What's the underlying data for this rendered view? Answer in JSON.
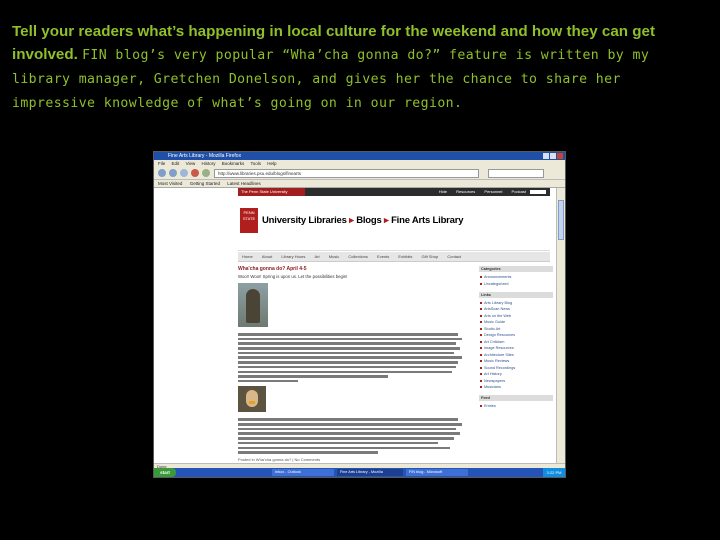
{
  "caption": {
    "lead": "Tell your readers what’s happening in local culture for the weekend and how they can get involved.",
    "rest": "FIN blog’s very popular “Wha’cha gonna do?” feature is written by my library manager, Gretchen Donelson, and gives her the chance to share her impressive knowledge of what’s going on in our region."
  },
  "browser": {
    "window_title": "Fine Arts Library - Mozilla Firefox",
    "menu": [
      "File",
      "Edit",
      "View",
      "History",
      "Bookmarks",
      "Tools",
      "Help"
    ],
    "url": "http://www.libraries.psu.edu/blogs/finearts",
    "bookmarks": [
      "Most Visited",
      "Getting Started",
      "Latest Headlines"
    ],
    "status": "Done"
  },
  "site": {
    "psu_label": "The Penn State University",
    "top_links": [
      "Hide",
      "Resources",
      "Personnel",
      "Podcast"
    ],
    "seal_text": "PENN STATE",
    "title_main": "University Libraries",
    "title_sep": "Blogs",
    "title_accent": "Fine Arts Library",
    "tabs": [
      "Home",
      "About",
      "Library Hours",
      "Art",
      "Music",
      "Collections",
      "Events",
      "Exhibits",
      "Gift Shop",
      "Contact"
    ]
  },
  "post": {
    "title": "Wha'cha gonna do? April 4-5",
    "subtitle": "Woo!! Woo!! Spring is upon us. Let the possibilities begin!",
    "byline": "Posted in Wha'cha gonna do? | No Comments"
  },
  "sidebar": {
    "categories_head": "Categories",
    "categories": [
      "Announcements",
      "Uncategorized"
    ],
    "links_head": "Links",
    "links": [
      "Arts Library Blog",
      "ArtsScan News",
      "Arts on the Web",
      "Music Guide",
      "Studio Art",
      "Design Resources",
      "Art Criticism",
      "Image Resources",
      "Architecture Sites",
      "Music Reviews",
      "Sound Recordings",
      "Art History",
      "Newspapers",
      "Musicians"
    ],
    "feed_head": "Feed",
    "feed": [
      "Entries"
    ]
  },
  "taskbar": {
    "start": "start",
    "tasks": [
      "Inbox - Outlook",
      "Fine Arts Library - Mozilla",
      "FIN blog - Microsoft"
    ],
    "clock": "3:22 PM"
  }
}
